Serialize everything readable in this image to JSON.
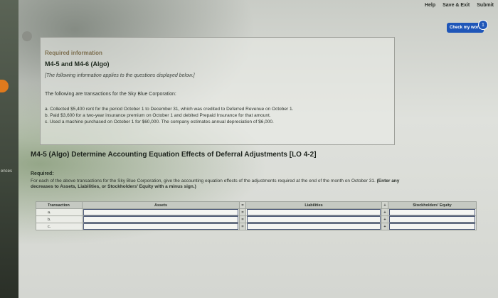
{
  "header": {
    "help": "Help",
    "save_exit": "Save & Exit",
    "submit": "Submit",
    "check_work": "Check my work",
    "check_badge": "1"
  },
  "sidebar": {
    "label": "ences"
  },
  "info": {
    "required_info": "Required information",
    "subtitle": "M4-5 and M4-6 (Algo)",
    "note": "[The following information applies to the questions displayed below.]",
    "intro": "The following are transactions for the Sky Blue Corporation:",
    "transactions": [
      "a. Collected $5,400 rent for the period October 1 to December 31, which was credited to Deferred Revenue on October 1.",
      "b. Paid $3,600 for a two-year insurance premium on October 1 and debited Prepaid Insurance for that amount.",
      "c. Used a machine purchased on October 1 for $60,000. The company estimates annual depreciation of $6,000."
    ]
  },
  "question": {
    "title": "M4-5 (Algo) Determine Accounting Equation Effects of Deferral Adjustments [LO 4-2]",
    "required_label": "Required:",
    "required_text": "For each of the above transactions for the Sky Blue Corporation, give the accounting equation effects of the adjustments required at the end of the month on October 31.",
    "required_bold": "(Enter any decreases to Assets, Liabilities, or Stockholders' Equity with a minus sign.)"
  },
  "table": {
    "headers": {
      "transaction": "Transaction",
      "assets": "Assets",
      "eq": "=",
      "liabilities": "Liabilities",
      "plus": "+",
      "equity": "Stockholders' Equity"
    },
    "rows": [
      {
        "label": "a."
      },
      {
        "label": "b."
      },
      {
        "label": "c."
      }
    ]
  }
}
